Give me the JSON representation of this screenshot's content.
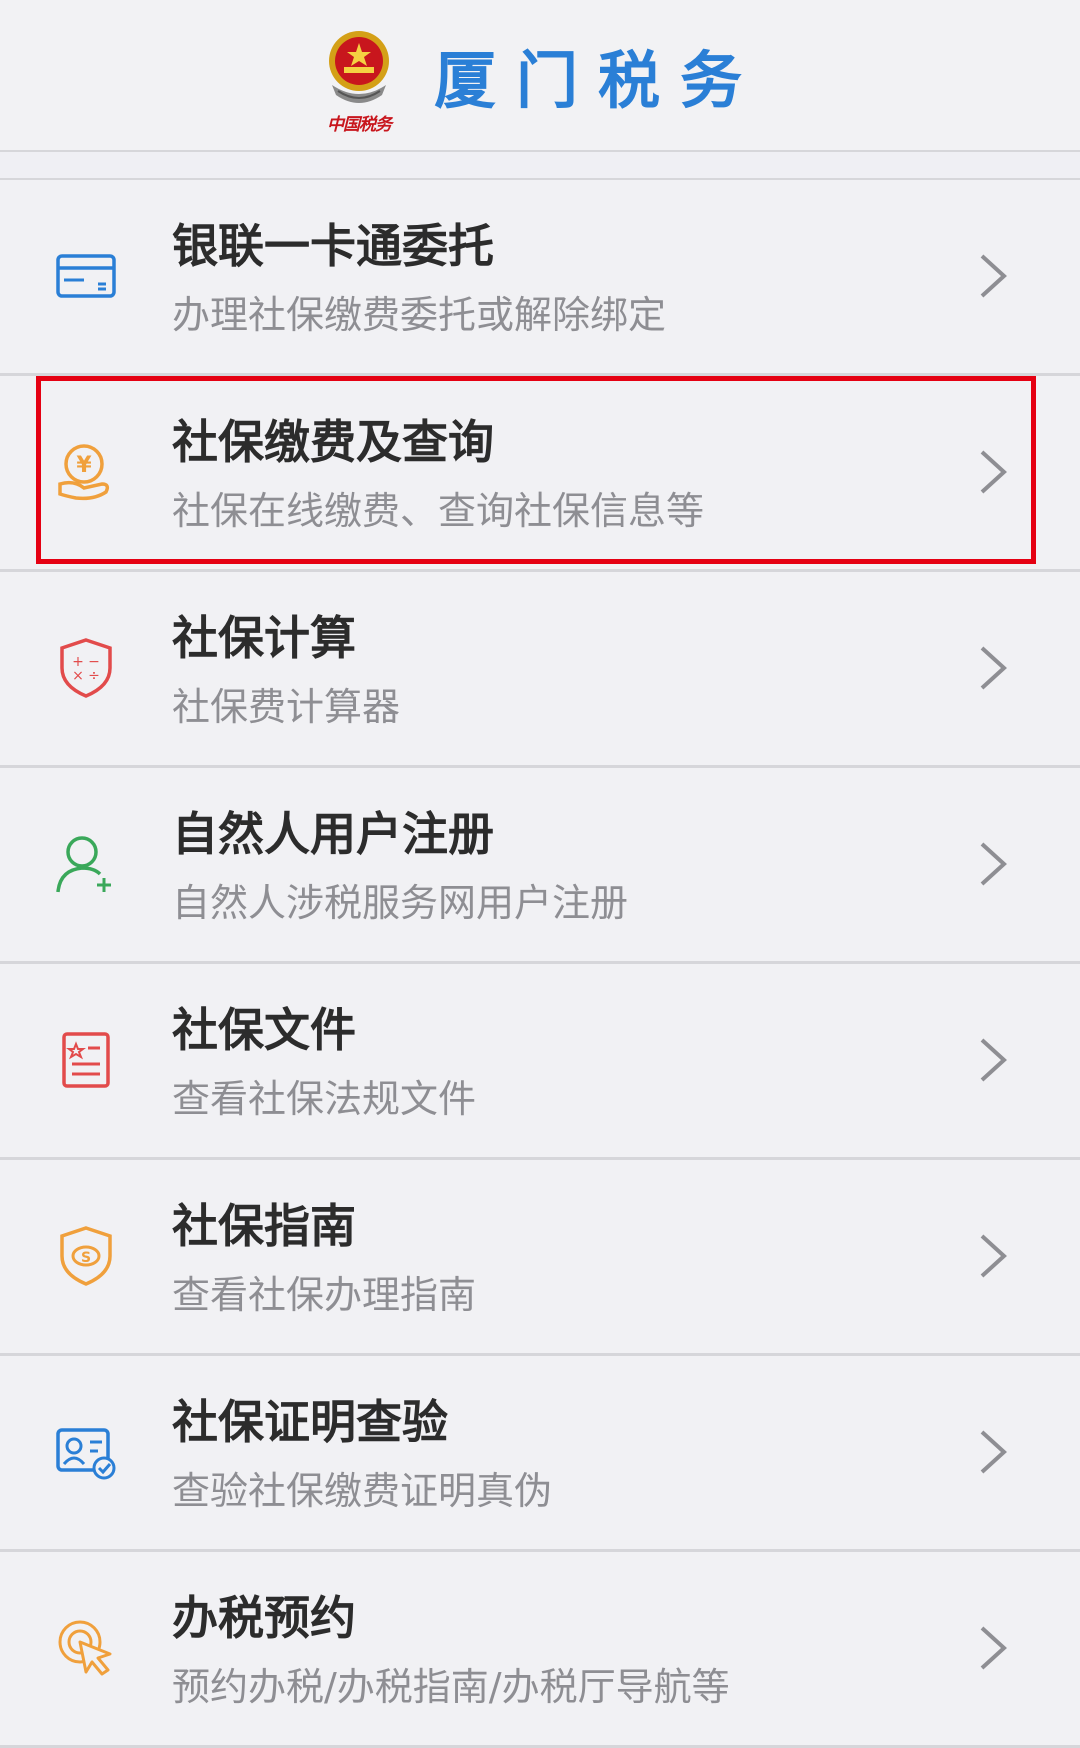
{
  "header": {
    "title": "厦门税务",
    "emblem_caption": "中国税务"
  },
  "colors": {
    "header_title": "#2a7fd6",
    "highlight": "#e50012",
    "icon_blue": "#2a7fd6",
    "icon_orange": "#f0a03c",
    "icon_red": "#e24b4b",
    "icon_green": "#3aa85a"
  },
  "items": [
    {
      "title": "银联一卡通委托",
      "subtitle": "办理社保缴费委托或解除绑定",
      "icon": "bank-card-icon"
    },
    {
      "title": "社保缴费及查询",
      "subtitle": "社保在线缴费、查询社保信息等",
      "icon": "yuan-hand-icon"
    },
    {
      "title": "社保计算",
      "subtitle": "社保费计算器",
      "icon": "calculator-shield-icon"
    },
    {
      "title": "自然人用户注册",
      "subtitle": "自然人涉税服务网用户注册",
      "icon": "add-user-icon"
    },
    {
      "title": "社保文件",
      "subtitle": "查看社保法规文件",
      "icon": "document-icon"
    },
    {
      "title": "社保指南",
      "subtitle": "查看社保办理指南",
      "icon": "guide-shield-icon"
    },
    {
      "title": "社保证明查验",
      "subtitle": "查验社保缴费证明真伪",
      "icon": "id-check-icon"
    },
    {
      "title": "办税预约",
      "subtitle": "预约办税/办税指南/办税厅导航等",
      "icon": "pointer-click-icon"
    }
  ]
}
